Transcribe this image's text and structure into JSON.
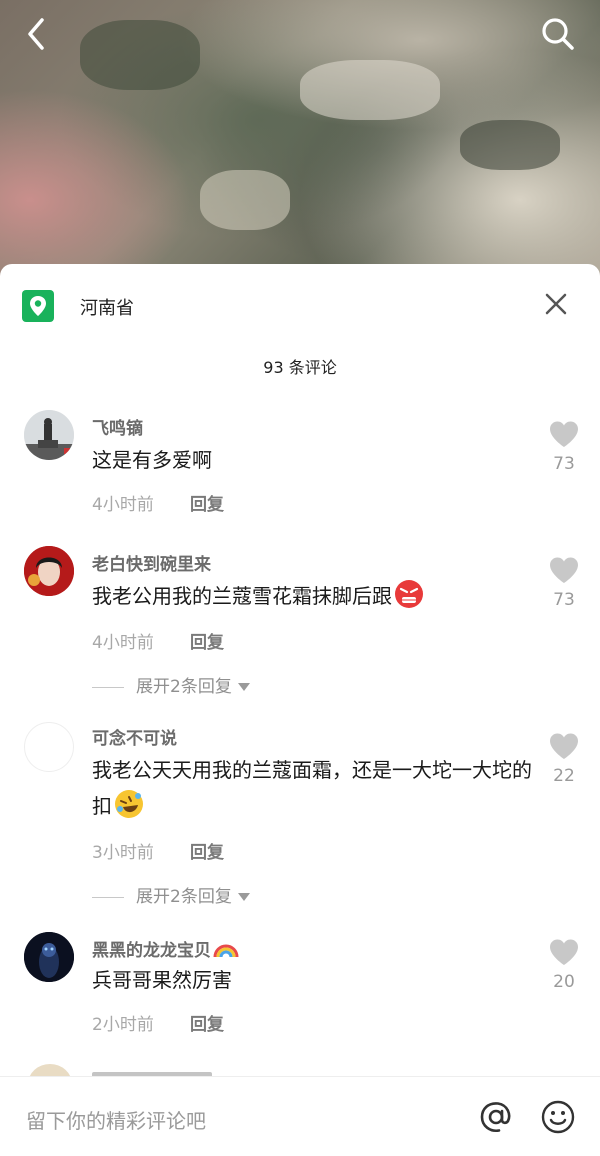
{
  "header": {
    "back_icon": "chevron-left-icon",
    "search_icon": "search-icon"
  },
  "sheet": {
    "location": "河南省",
    "location_icon": "location-pin-icon",
    "close_icon": "close-icon",
    "count_text": "93 条评论"
  },
  "comments": [
    {
      "name": "飞鸣镝",
      "text": "这是有多爱啊",
      "time": "4小时前",
      "reply": "回复",
      "likes": "73"
    },
    {
      "name": "老白快到碗里来",
      "text": "我老公用我的兰蔻雪花霜抹脚后跟",
      "emoji": "angry-face-emoji",
      "time": "4小时前",
      "reply": "回复",
      "likes": "73",
      "expand": "展开2条回复"
    },
    {
      "name": "可念不可说",
      "text": "我老公天天用我的兰蔻面霜，还是一大坨一大坨的扣",
      "emoji": "rolling-laughing-emoji",
      "time": "3小时前",
      "reply": "回复",
      "likes": "22",
      "expand": "展开2条回复"
    },
    {
      "name": "黑黑的龙龙宝贝",
      "name_emoji": "rainbow-emoji",
      "text": "兵哥哥果然厉害",
      "time": "2小时前",
      "reply": "回复",
      "likes": "20"
    }
  ],
  "input": {
    "placeholder": "留下你的精彩评论吧",
    "at_icon": "at-icon",
    "emoji_icon": "smiley-icon"
  },
  "colors": {
    "location_green": "#19b25b",
    "like_gray": "#c8c8c8"
  }
}
